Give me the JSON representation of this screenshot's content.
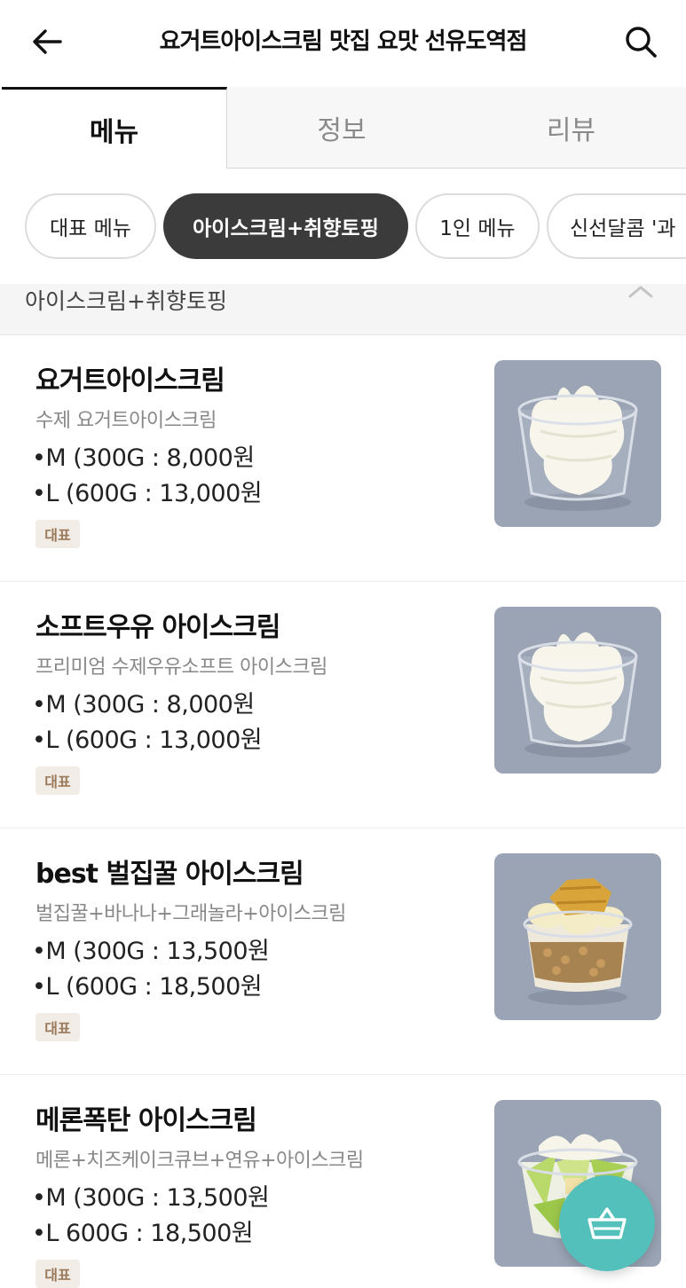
{
  "header": {
    "title": "요거트아이스크림 맛집 요맛 선유도역점",
    "back_icon": "arrow-left-icon",
    "search_icon": "search-icon"
  },
  "tabs": [
    {
      "label": "메뉴",
      "active": true
    },
    {
      "label": "정보",
      "active": false
    },
    {
      "label": "리뷰",
      "active": false
    }
  ],
  "categories": [
    {
      "label": "대표 메뉴",
      "selected": false
    },
    {
      "label": "아이스크림+취향토핑",
      "selected": true
    },
    {
      "label": "1인 메뉴",
      "selected": false
    },
    {
      "label": "신선달콤 '과",
      "selected": false
    }
  ],
  "section": {
    "title": "아이스크림+취향토핑",
    "collapse_icon": "chevron-up-icon"
  },
  "items": [
    {
      "name": "요거트아이스크림",
      "description": "수제 요거트아이스크림",
      "price_m": "•M (300G : 8,000원",
      "price_l": "•L (600G : 13,000원",
      "badge": "대표",
      "image": "soft-serve-cup-image"
    },
    {
      "name": "소프트우유 아이스크림",
      "description": "프리미엄 수제우유소프트 아이스크림",
      "price_m": "•M (300G : 8,000원",
      "price_l": "•L (600G : 13,000원",
      "badge": "대표",
      "image": "soft-serve-cup-image"
    },
    {
      "name": "best 벌집꿀 아이스크림",
      "description": "벌집꿀+바나나+그래놀라+아이스크림",
      "price_m": "•M (300G : 13,500원",
      "price_l": "•L (600G : 18,500원",
      "badge": "대표",
      "image": "honeycomb-banana-cup-image"
    },
    {
      "name": "메론폭탄 아이스크림",
      "description": "메론+치즈케이크큐브+연유+아이스크림",
      "price_m": "•M (300G : 13,500원",
      "price_l": "•L 600G : 18,500원",
      "badge": "대표",
      "image": "melon-cup-image"
    }
  ],
  "cart_button": {
    "icon": "basket-icon"
  },
  "colors": {
    "accent_teal": "#54c0bb",
    "chip_selected": "#3b3b3b",
    "badge_bg": "#f1ece6",
    "badge_text": "#9b7a5b",
    "photo_bg": "#9aa4b4"
  }
}
